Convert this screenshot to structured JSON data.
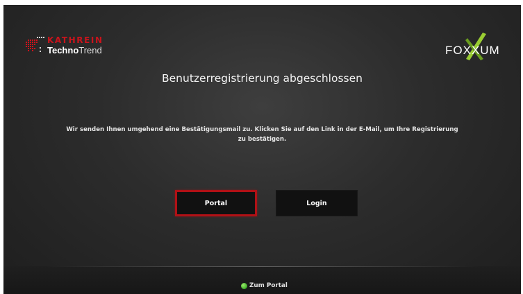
{
  "header": {
    "brand_name": "KATHREIN",
    "brand_sub_bold": "Techno",
    "brand_sub_light": "Trend",
    "partner_logo": "FOXXUM"
  },
  "dialog": {
    "title": "Benutzerregistrierung abgeschlossen",
    "message": "Wir senden Ihnen umgehend eine Bestätigungsmail zu. Klicken Sie auf den Link in der E-Mail, um Ihre Registrierung zu bestätigen."
  },
  "buttons": {
    "portal_label": "Portal",
    "login_label": "Login"
  },
  "footer": {
    "hint_label": "Zum Portal",
    "hint_icon": "green-button-icon"
  },
  "colors": {
    "background": "#2c2c2c",
    "focus_border": "#b01116",
    "brand_red": "#c9141c",
    "button_fill": "#111111",
    "hint_green": "#3eae2a"
  }
}
